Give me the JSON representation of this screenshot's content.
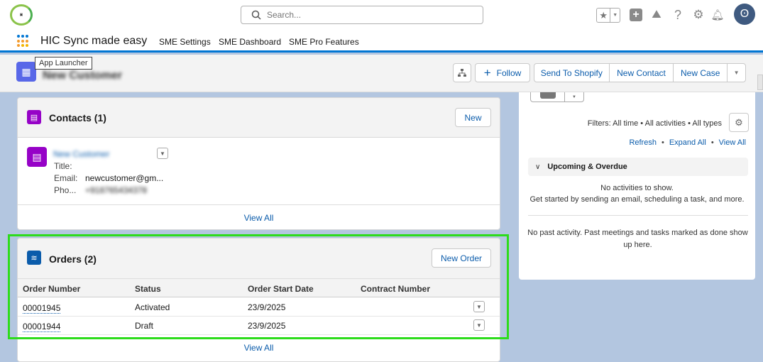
{
  "header": {
    "search_placeholder": "Search...",
    "logo_text": "Sync made easy"
  },
  "nav": {
    "app_name": "HIC Sync made easy",
    "items": [
      {
        "label": "SME Settings"
      },
      {
        "label": "SME Dashboard"
      },
      {
        "label": "SME Pro Features"
      }
    ]
  },
  "tooltip": "App Launcher",
  "record": {
    "title": "New Customer",
    "actions": {
      "follow": "Follow",
      "send_to_shopify": "Send To Shopify",
      "new_contact": "New Contact",
      "new_case": "New Case"
    }
  },
  "contacts": {
    "title": "Contacts (1)",
    "new_label": "New",
    "contact": {
      "name": "New Customer",
      "title_label": "Title:",
      "email_label": "Email:",
      "email": "newcustomer@gm...",
      "phone_label": "Pho...",
      "phone": "+918765434378"
    },
    "view_all": "View All"
  },
  "orders": {
    "title": "Orders (2)",
    "new_label": "New Order",
    "columns": [
      "Order Number",
      "Status",
      "Order Start Date",
      "Contract Number"
    ],
    "rows": [
      {
        "number": "00001945",
        "status": "Activated",
        "start": "23/9/2025",
        "contract": ""
      },
      {
        "number": "00001944",
        "status": "Draft",
        "start": "23/9/2025",
        "contract": ""
      }
    ],
    "view_all": "View All"
  },
  "activity": {
    "filters": "Filters: All time • All activities • All types",
    "refresh": "Refresh",
    "expand_all": "Expand All",
    "view_all": "View All",
    "sep": "•",
    "upcoming": "Upcoming & Overdue",
    "no_activities": "No activities to show.",
    "get_started": "Get started by sending an email, scheduling a task, and more.",
    "no_past": "No past activity. Past meetings and tasks marked as done show up here."
  },
  "colors": {
    "accent": "#0176d3",
    "highlight": "#2ddc1b",
    "contact_icon": "#9602c7",
    "order_icon": "#0b5cab"
  }
}
